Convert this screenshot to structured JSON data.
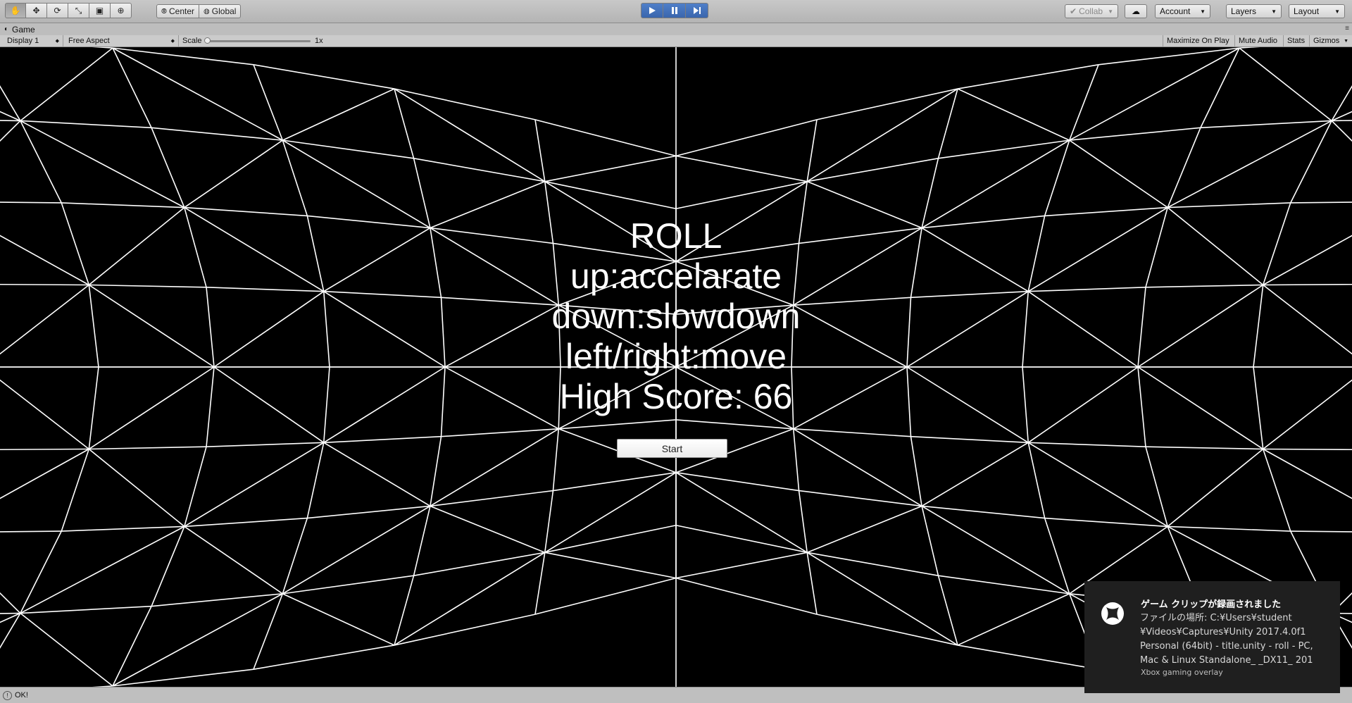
{
  "toolbar": {
    "transform_tools": [
      {
        "name": "hand-tool-icon",
        "glyph": "✋"
      },
      {
        "name": "move-tool-icon",
        "glyph": "✥"
      },
      {
        "name": "rotate-tool-icon",
        "glyph": "⟳"
      },
      {
        "name": "scale-tool-icon",
        "glyph": "⤡"
      },
      {
        "name": "rect-tool-icon",
        "glyph": "▣"
      },
      {
        "name": "transform-tool-icon",
        "glyph": "⊕"
      }
    ],
    "pivot_mode": "Center",
    "pivot_rotation": "Global",
    "collab_label": "Collab",
    "account_label": "Account",
    "layers_label": "Layers",
    "layout_label": "Layout"
  },
  "game_tab": {
    "title": "Game"
  },
  "game_bar": {
    "display": "Display 1",
    "aspect": "Free Aspect",
    "scale_label": "Scale",
    "scale_value": "1x",
    "scale_fraction": 0.0,
    "maximize_on_play": "Maximize On Play",
    "mute_audio": "Mute Audio",
    "stats": "Stats",
    "gizmos": "Gizmos"
  },
  "game": {
    "title": "ROLL",
    "line_up": "up:accelarate",
    "line_down": "down:slowdown",
    "line_move": "left/right:move",
    "high_score": "High Score: 66",
    "start_button": "Start"
  },
  "status": {
    "text": "OK!"
  },
  "toast": {
    "title": "ゲーム クリップが録画されました",
    "body": "ファイルの場所: C:¥Users¥student\n¥Videos¥Captures¥Unity 2017.4.0f1\nPersonal (64bit) - title.unity - roll - PC,\nMac & Linux Standalone_ _DX11_ 201",
    "source": "Xbox gaming overlay"
  }
}
